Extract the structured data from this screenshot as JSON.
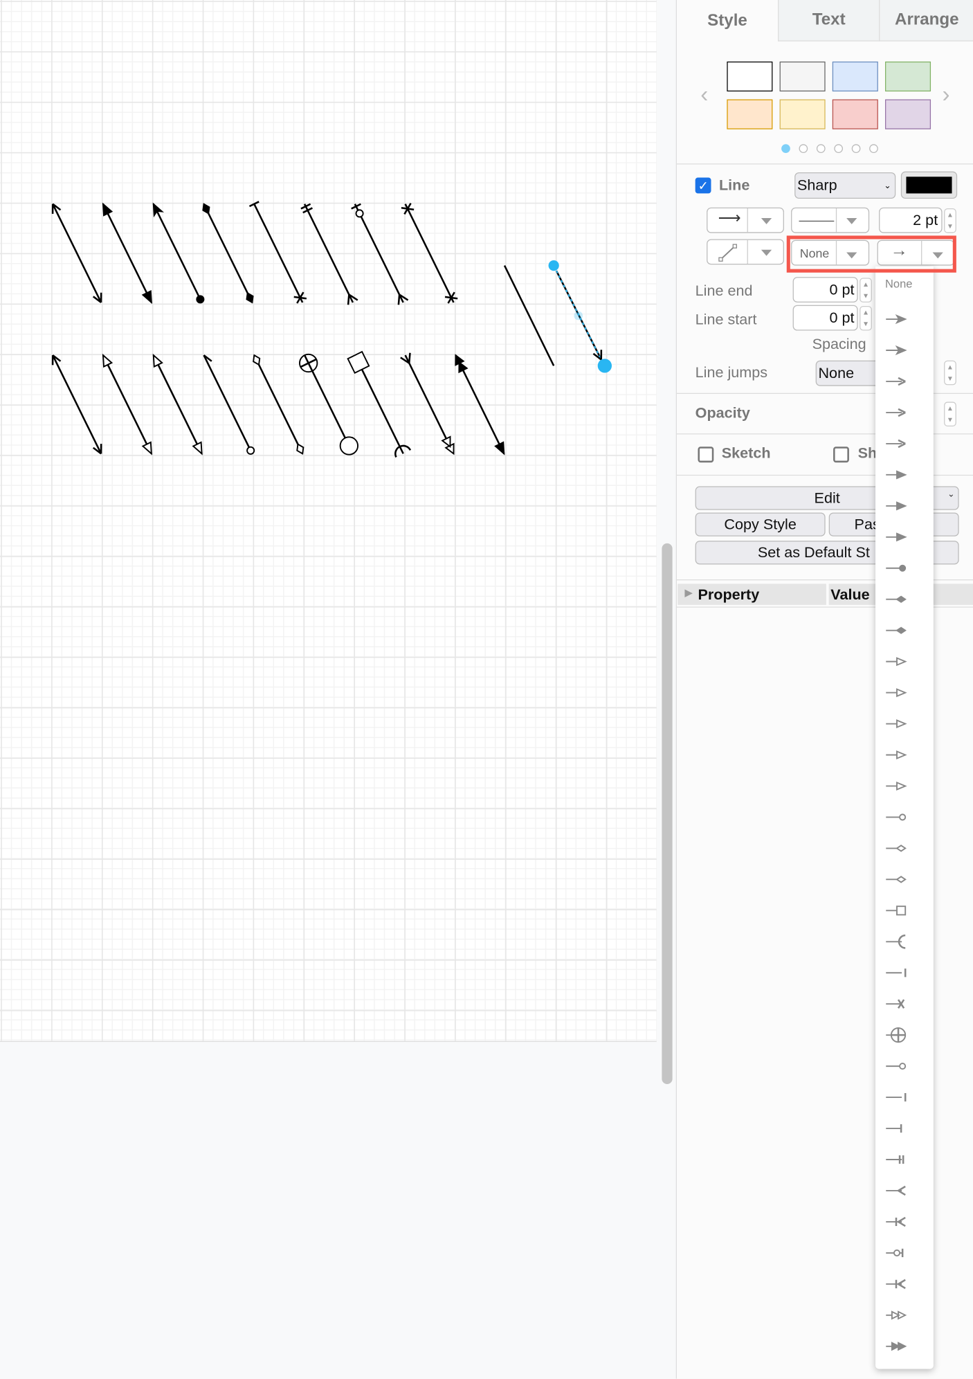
{
  "canvas": {
    "arrows": [
      {
        "start": "open",
        "end": "open"
      },
      {
        "start": "block",
        "end": "block"
      },
      {
        "start": "classic",
        "end": "oval"
      },
      {
        "start": "diamond",
        "end": "diamond"
      },
      {
        "start": "dash",
        "end": "cross"
      },
      {
        "start": "doubleDash",
        "end": "many"
      },
      {
        "start": "ovalOpenDash",
        "end": "many"
      },
      {
        "start": "cross",
        "end": "cross"
      },
      {
        "start": "open",
        "end": "open"
      },
      {
        "start": "blockOpen",
        "end": "blockOpen"
      },
      {
        "start": "classicOpen",
        "end": "classicOpen"
      },
      {
        "start": "halfArrow",
        "end": "ovalOpen"
      },
      {
        "start": "diamondOpen",
        "end": "diamondOpen"
      },
      {
        "start": "circlePlus",
        "end": "circle"
      },
      {
        "start": "boxBig",
        "end": "halfCircle"
      },
      {
        "start": "many",
        "end": "doubleBlockOpen"
      },
      {
        "start": "doubleBlock",
        "end": "block"
      }
    ],
    "selection_color": "#29b6f2"
  },
  "panel": {
    "tabs": [
      {
        "label": "Style",
        "active": true
      },
      {
        "label": "Text",
        "active": false
      },
      {
        "label": "Arrange",
        "active": false
      }
    ],
    "swatches": [
      {
        "fill": "#ffffff",
        "stroke": "#000000"
      },
      {
        "fill": "#f5f5f5",
        "stroke": "#666666"
      },
      {
        "fill": "#dae8fc",
        "stroke": "#6c8ebf"
      },
      {
        "fill": "#d5e8d4",
        "stroke": "#82b366"
      },
      {
        "fill": "#ffe6cc",
        "stroke": "#d79b00"
      },
      {
        "fill": "#fff2cc",
        "stroke": "#d6b656"
      },
      {
        "fill": "#f8cecc",
        "stroke": "#b85450"
      },
      {
        "fill": "#e1d5e7",
        "stroke": "#9673a6"
      }
    ],
    "page_dots": 6,
    "active_dot": 0,
    "line": {
      "label": "Line",
      "checked": true,
      "style": "Sharp",
      "color": "#000000",
      "width": "2 pt",
      "start_marker": "None",
      "end_marker": "classic-arrow"
    },
    "line_end": {
      "label": "Line end",
      "value": "0 pt"
    },
    "line_start": {
      "label": "Line start",
      "value": "0 pt"
    },
    "spacing_label": "Spacing",
    "line_jumps": {
      "label": "Line jumps",
      "value": "None"
    },
    "opacity_label": "Opacity",
    "sketch_label": "Sketch",
    "shadow_label": "Sh",
    "edit_label": "Edit",
    "copy_style_label": "Copy Style",
    "paste_style_label": "Pas",
    "set_default_label": "Set as Default St",
    "property_header": "Property",
    "value_header": "Value"
  },
  "dropdown": {
    "none_label": "None",
    "items": [
      "classic",
      "classicThin",
      "open",
      "openThin",
      "openAsync",
      "block",
      "blockThin",
      "async",
      "oval",
      "diamond",
      "diamondThin",
      "classic-open",
      "classicThin-open",
      "block-open",
      "blockThin-open",
      "async-open",
      "oval-open",
      "diamond-open",
      "diamondThin-open",
      "box",
      "halfCircle",
      "dash",
      "cross",
      "circlePlus",
      "circle",
      "baseDash",
      "ERone",
      "ERmandOne",
      "ERmany",
      "ERoneToMany",
      "ERzeroToOne",
      "ERzeroToMany",
      "doubleBlock-open",
      "doubleBlock"
    ]
  }
}
